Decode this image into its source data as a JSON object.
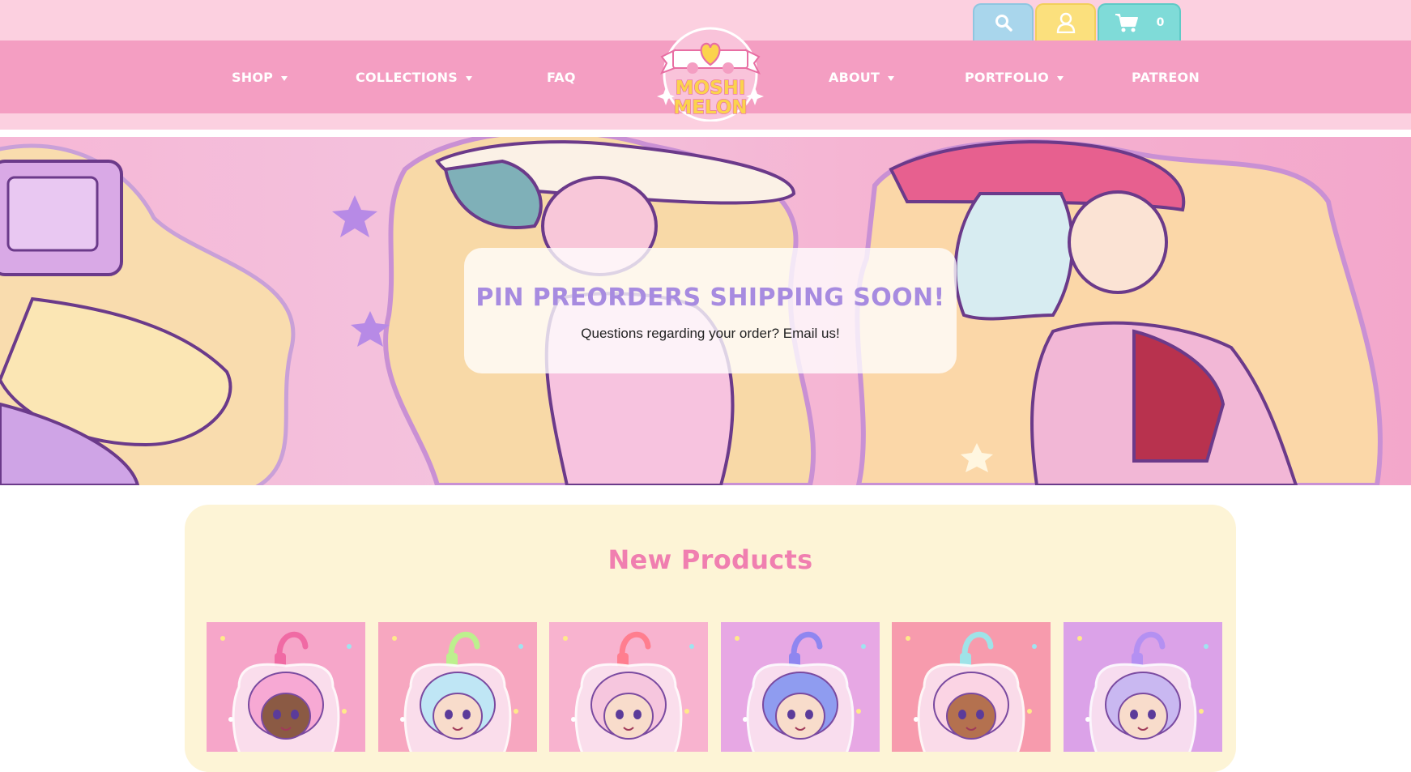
{
  "utility": {
    "search_icon": "search-icon",
    "account_icon": "user-icon",
    "cart_icon": "cart-icon",
    "cart_count": "0"
  },
  "nav": {
    "items": [
      {
        "label": "SHOP",
        "has_dropdown": true
      },
      {
        "label": "COLLECTIONS",
        "has_dropdown": true
      },
      {
        "label": "FAQ",
        "has_dropdown": false
      },
      {
        "label": "ABOUT",
        "has_dropdown": true
      },
      {
        "label": "PORTFOLIO",
        "has_dropdown": true
      },
      {
        "label": "PATREON",
        "has_dropdown": false
      }
    ]
  },
  "logo": {
    "line1": "MOSHI",
    "line2": "MELON"
  },
  "hero": {
    "title": "PIN PREORDERS SHIPPING SOON!",
    "subtitle": "Questions regarding your order? Email us!"
  },
  "products": {
    "heading": "New Products",
    "items": [
      {
        "bg": "#f6a6c9",
        "hair": "#f7a9d4",
        "skin": "#8b5a44",
        "clip": "#f06aa4"
      },
      {
        "bg": "#f7a7c0",
        "hair": "#bfe6f5",
        "skin": "#f8dccb",
        "clip": "#bdf08e"
      },
      {
        "bg": "#f8b3cf",
        "hair": "#f6c6de",
        "skin": "#f8dccb",
        "clip": "#ff7e8f"
      },
      {
        "bg": "#e7a8e4",
        "hair": "#8f9cf0",
        "skin": "#f8dccb",
        "clip": "#8f86f0"
      },
      {
        "bg": "#f79bad",
        "hair": "#fbd4e4",
        "skin": "#b4714f",
        "clip": "#9fe3e8"
      },
      {
        "bg": "#dba2e8",
        "hair": "#c9b8f1",
        "skin": "#f8dccb",
        "clip": "#b490f2"
      }
    ]
  },
  "colors": {
    "nav_pink": "#f49ec2",
    "light_pink": "#fcd0e0",
    "hero_title": "#a78be0",
    "products_heading": "#f07fb0",
    "products_bg": "#fdf4d6"
  }
}
